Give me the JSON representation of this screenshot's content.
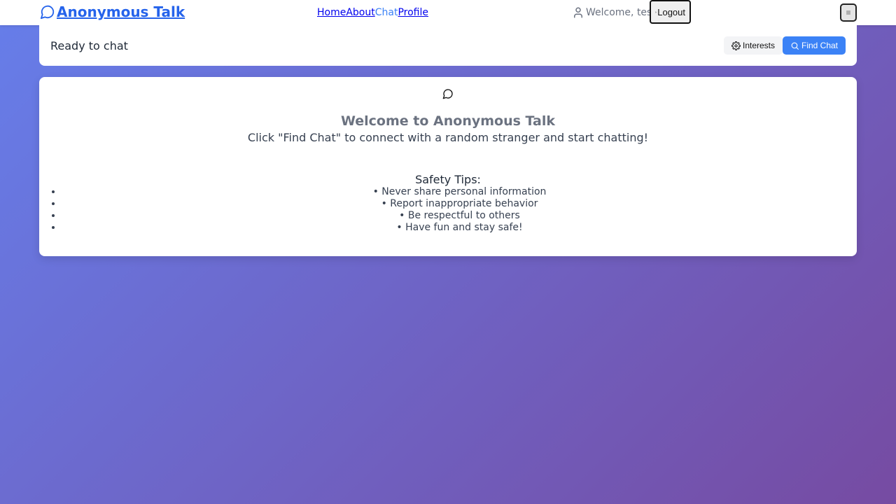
{
  "navbar": {
    "brand": "Anonymous Talk",
    "links": [
      {
        "label": "Home"
      },
      {
        "label": "About"
      },
      {
        "label": "Chat",
        "active": true
      },
      {
        "label": "Profile"
      }
    ],
    "welcome_text": "Welcome, test",
    "logout_label": "Logout",
    "icons": {
      "brand": "chat-bubble-icon",
      "user": "user-icon",
      "logout": "logout-icon",
      "menu": "hamburger-menu-icon"
    }
  },
  "status_bar": {
    "status": "Ready to chat",
    "interests_label": "Interests",
    "find_label": "Find Chat",
    "icons": {
      "interests": "gear-icon",
      "find": "search-icon"
    }
  },
  "main": {
    "title": "Welcome to Anonymous Talk",
    "subtitle": "Click \"Find Chat\" to connect with a random stranger and start chatting!",
    "tips_title": "Safety Tips:",
    "tips": [
      "• Never share personal information",
      "• Report inappropriate behavior",
      "• Be respectful to others",
      "• Have fun and stay safe!"
    ],
    "icon": "chat-bubble-icon"
  },
  "colors": {
    "accent": "#3b82f6",
    "brand": "#2563eb",
    "background_gradient": [
      "#667eea",
      "#764ba2"
    ]
  }
}
